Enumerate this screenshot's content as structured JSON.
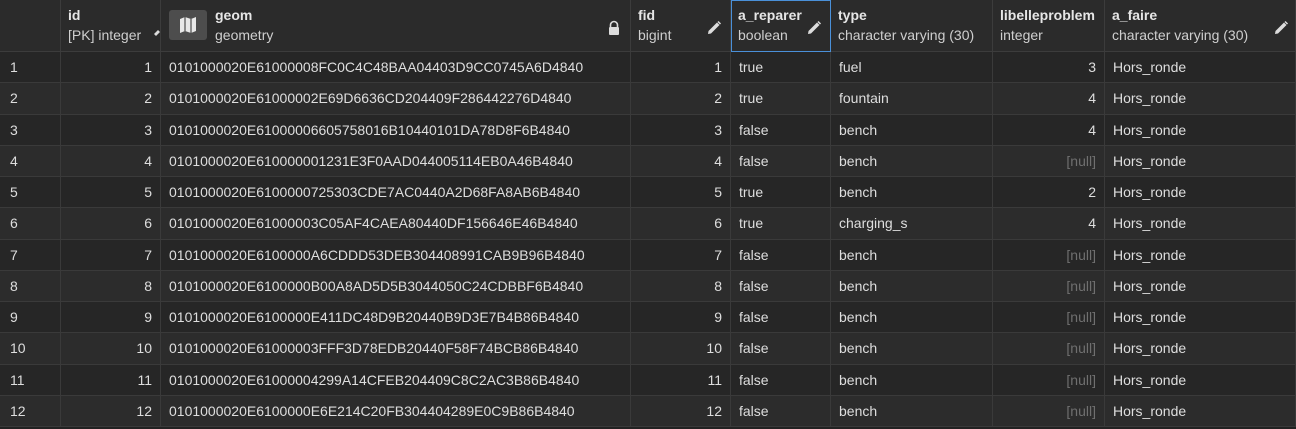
{
  "columns": [
    {
      "name": "",
      "type": ""
    },
    {
      "name": "id",
      "type": "[PK] integer"
    },
    {
      "name": "geom",
      "type": "geometry"
    },
    {
      "name": "fid",
      "type": "bigint"
    },
    {
      "name": "a_reparer",
      "type": "boolean"
    },
    {
      "name": "type",
      "type": "character varying (30)"
    },
    {
      "name": "libelleproblem",
      "type": "integer"
    },
    {
      "name": "a_faire",
      "type": "character varying (30)"
    }
  ],
  "rows": [
    {
      "n": "1",
      "id": "1",
      "geom": "0101000020E61000008FC0C4C48BAA04403D9CC0745A6D4840",
      "fid": "1",
      "a_reparer": "true",
      "type": "fuel",
      "libelleproblem": "3",
      "a_faire": "Hors_ronde"
    },
    {
      "n": "2",
      "id": "2",
      "geom": "0101000020E61000002E69D6636CD204409F286442276D4840",
      "fid": "2",
      "a_reparer": "true",
      "type": "fountain",
      "libelleproblem": "4",
      "a_faire": "Hors_ronde"
    },
    {
      "n": "3",
      "id": "3",
      "geom": "0101000020E61000006605758016B10440101DA78D8F6B4840",
      "fid": "3",
      "a_reparer": "false",
      "type": "bench",
      "libelleproblem": "4",
      "a_faire": "Hors_ronde"
    },
    {
      "n": "4",
      "id": "4",
      "geom": "0101000020E610000001231E3F0AAD044005114EB0A46B4840",
      "fid": "4",
      "a_reparer": "false",
      "type": "bench",
      "libelleproblem": "[null]",
      "a_faire": "Hors_ronde"
    },
    {
      "n": "5",
      "id": "5",
      "geom": "0101000020E6100000725303CDE7AC0440A2D68FA8AB6B4840",
      "fid": "5",
      "a_reparer": "true",
      "type": "bench",
      "libelleproblem": "2",
      "a_faire": "Hors_ronde"
    },
    {
      "n": "6",
      "id": "6",
      "geom": "0101000020E61000003C05AF4CAEA80440DF156646E46B4840",
      "fid": "6",
      "a_reparer": "true",
      "type": "charging_s",
      "libelleproblem": "4",
      "a_faire": "Hors_ronde"
    },
    {
      "n": "7",
      "id": "7",
      "geom": "0101000020E6100000A6CDDD53DEB304408991CAB9B96B4840",
      "fid": "7",
      "a_reparer": "false",
      "type": "bench",
      "libelleproblem": "[null]",
      "a_faire": "Hors_ronde"
    },
    {
      "n": "8",
      "id": "8",
      "geom": "0101000020E6100000B00A8AD5D5B3044050C24CDBBF6B4840",
      "fid": "8",
      "a_reparer": "false",
      "type": "bench",
      "libelleproblem": "[null]",
      "a_faire": "Hors_ronde"
    },
    {
      "n": "9",
      "id": "9",
      "geom": "0101000020E6100000E411DC48D9B20440B9D3E7B4B86B4840",
      "fid": "9",
      "a_reparer": "false",
      "type": "bench",
      "libelleproblem": "[null]",
      "a_faire": "Hors_ronde"
    },
    {
      "n": "10",
      "id": "10",
      "geom": "0101000020E61000003FFF3D78EDB20440F58F74BCB86B4840",
      "fid": "10",
      "a_reparer": "false",
      "type": "bench",
      "libelleproblem": "[null]",
      "a_faire": "Hors_ronde"
    },
    {
      "n": "11",
      "id": "11",
      "geom": "0101000020E61000004299A14CFEB204409C8C2AC3B86B4840",
      "fid": "11",
      "a_reparer": "false",
      "type": "bench",
      "libelleproblem": "[null]",
      "a_faire": "Hors_ronde"
    },
    {
      "n": "12",
      "id": "12",
      "geom": "0101000020E6100000E6E214C20FB304404289E0C9B86B4840",
      "fid": "12",
      "a_reparer": "false",
      "type": "bench",
      "libelleproblem": "[null]",
      "a_faire": "Hors_ronde"
    }
  ],
  "icons": {
    "map": "map-icon",
    "lock": "lock-icon",
    "edit": "pencil-icon"
  },
  "colors": {
    "active_border": "#4a90d9",
    "null_text": "#6f6f6f"
  }
}
